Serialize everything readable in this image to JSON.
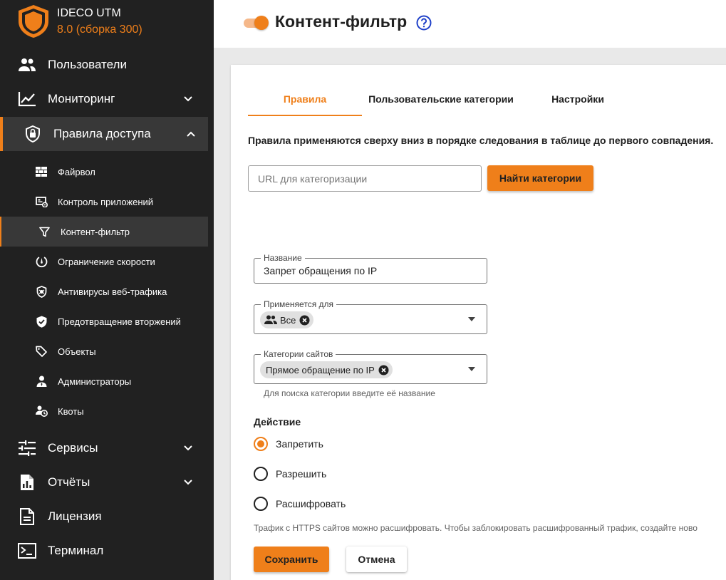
{
  "brand": {
    "name": "IDECO UTM",
    "version": "8.0 (сборка 300)",
    "logo_icon": "shield-logo-icon",
    "accent_color": "#ef7f1a"
  },
  "sidebar": {
    "items": [
      {
        "label": "Пользователи",
        "icon": "users-icon"
      },
      {
        "label": "Мониторинг",
        "icon": "chart-line-icon",
        "expandable": true
      },
      {
        "label": "Правила доступа",
        "icon": "lock-shield-icon",
        "expanded": true
      },
      {
        "label": "Сервисы",
        "icon": "sliders-icon",
        "expandable": true
      },
      {
        "label": "Отчёты",
        "icon": "report-icon",
        "expandable": true
      },
      {
        "label": "Лицензия",
        "icon": "document-icon"
      },
      {
        "label": "Терминал",
        "icon": "terminal-icon"
      }
    ],
    "subitems": [
      {
        "label": "Файрвол",
        "icon": "firewall-icon"
      },
      {
        "label": "Контроль приложений",
        "icon": "app-control-icon"
      },
      {
        "label": "Контент-фильтр",
        "icon": "filter-icon",
        "active": true
      },
      {
        "label": "Ограничение скорости",
        "icon": "speed-icon"
      },
      {
        "label": "Антивирусы веб-трафика",
        "icon": "antivirus-icon"
      },
      {
        "label": "Предотвращение вторжений",
        "icon": "shield-check-icon"
      },
      {
        "label": "Объекты",
        "icon": "tag-icon"
      },
      {
        "label": "Администраторы",
        "icon": "admin-icon"
      },
      {
        "label": "Квоты",
        "icon": "quota-icon"
      }
    ]
  },
  "header": {
    "title": "Контент-фильтр",
    "toggle_on": true,
    "help_icon": "help-circle-icon"
  },
  "tabs": [
    {
      "label": "Правила",
      "active": true
    },
    {
      "label": "Пользовательские категории"
    },
    {
      "label": "Настройки"
    }
  ],
  "notice": "Правила применяются сверху вниз в порядке следования в таблице до первого совпадения.",
  "url_search": {
    "placeholder": "URL для категоризации",
    "button_label": "Найти категории"
  },
  "form": {
    "name": {
      "label": "Название",
      "value": "Запрет обращения по IP"
    },
    "applies_to": {
      "label": "Применяется для",
      "chip": "Все"
    },
    "categories": {
      "label": "Категории сайтов",
      "chip": "Прямое обращение по IP",
      "hint": "Для поиска категории введите её название"
    },
    "action": {
      "title": "Действие",
      "options": [
        {
          "label": "Запретить",
          "checked": true
        },
        {
          "label": "Разрешить",
          "checked": false
        },
        {
          "label": "Расшифровать",
          "checked": false
        }
      ]
    },
    "https_note": "Трафик с HTTPS сайтов можно расшифровать. Чтобы заблокировать расшифрованный трафик, создайте ново",
    "save_label": "Сохранить",
    "cancel_label": "Отмена"
  }
}
